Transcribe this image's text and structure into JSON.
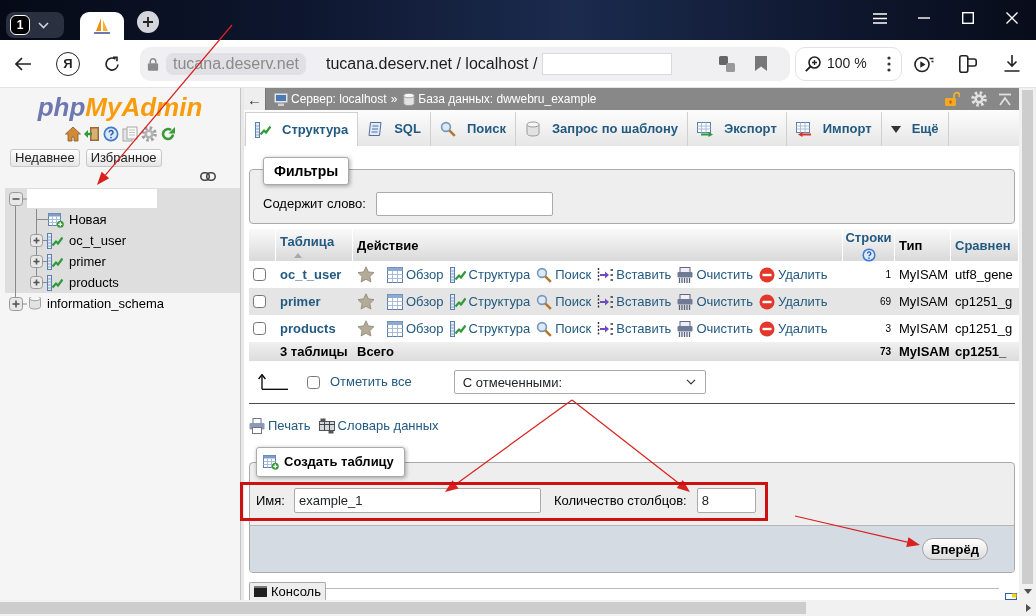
{
  "browser": {
    "tab_counter": "1",
    "logo_letter": "Я",
    "address_chip": "tucana.deserv.net",
    "address": "tucana.deserv.net / localhost /",
    "address_redacted": true,
    "zoom": "100 %"
  },
  "sidebar": {
    "logo": [
      {
        "text": "php",
        "color": "#6c78af"
      },
      {
        "text": "MyAdmin",
        "color": "#f89c0e"
      }
    ],
    "buttons": [
      "Недавнее",
      "Избранное"
    ],
    "tree": [
      {
        "kind": "database",
        "redacted": true,
        "selected": true,
        "expanded": true,
        "children": [
          {
            "kind": "new",
            "label": "Новая"
          },
          {
            "kind": "table",
            "label": "oc_t_user",
            "expanded": false
          },
          {
            "kind": "table",
            "label": "primer",
            "expanded": false
          },
          {
            "kind": "table",
            "label": "products",
            "expanded": false
          }
        ]
      },
      {
        "kind": "database",
        "label": "information_schema",
        "redacted": false,
        "selected": false,
        "expanded": false
      }
    ]
  },
  "main": {
    "nav_toggle": "←",
    "breadcrumbs": [
      {
        "kind": "server",
        "label": "Сервер: localhost",
        "separator": "»"
      },
      {
        "kind": "database",
        "label": "База данных: dwwebru_example"
      }
    ],
    "tabs": [
      {
        "kind": "structure",
        "label": "Структура",
        "selected": true
      },
      {
        "kind": "sql",
        "label": "SQL",
        "selected": false
      },
      {
        "kind": "search",
        "label": "Поиск",
        "selected": false
      },
      {
        "kind": "query",
        "label": "Запрос по шаблону",
        "selected": false
      },
      {
        "kind": "export",
        "label": "Экспорт",
        "selected": false
      },
      {
        "kind": "import",
        "label": "Импорт",
        "selected": false
      },
      {
        "kind": "more",
        "label": "Ещё",
        "selected": false
      }
    ],
    "filters": {
      "legend": "Фильтры",
      "label": "Содержит слово:"
    },
    "table": {
      "columns": [
        {
          "kind": "sortable",
          "label": "Таблица",
          "sorted": true,
          "help": false
        },
        {
          "kind": "plain",
          "label": "Действие",
          "sorted": false,
          "help": false
        },
        {
          "kind": "sortable",
          "label": "Строки",
          "sorted": false,
          "help": true
        },
        {
          "kind": "plain",
          "label": "Тип",
          "sorted": false,
          "help": false
        },
        {
          "kind": "sortable",
          "label": "Сравнен",
          "sorted": false,
          "help": false
        }
      ],
      "rows": [
        {
          "checked": false,
          "name": "oc_t_user",
          "favorite": false,
          "actions": [
            {
              "kind": "browse",
              "label": "Обзор"
            },
            {
              "kind": "structure",
              "label": "Структура"
            },
            {
              "kind": "search",
              "label": "Поиск"
            },
            {
              "kind": "insert",
              "label": "Вставить"
            },
            {
              "kind": "empty",
              "label": "Очистить"
            },
            {
              "kind": "drop",
              "label": "Удалить"
            }
          ],
          "row_count": "1",
          "engine": "MyISAM",
          "collation": "utf8_gene"
        },
        {
          "checked": false,
          "name": "primer",
          "favorite": false,
          "actions": [
            {
              "kind": "browse",
              "label": "Обзор"
            },
            {
              "kind": "structure",
              "label": "Структура"
            },
            {
              "kind": "search",
              "label": "Поиск"
            },
            {
              "kind": "insert",
              "label": "Вставить"
            },
            {
              "kind": "empty",
              "label": "Очистить"
            },
            {
              "kind": "drop",
              "label": "Удалить"
            }
          ],
          "row_count": "69",
          "engine": "MyISAM",
          "collation": "cp1251_g"
        },
        {
          "checked": false,
          "name": "products",
          "favorite": false,
          "actions": [
            {
              "kind": "browse",
              "label": "Обзор"
            },
            {
              "kind": "structure",
              "label": "Структура"
            },
            {
              "kind": "search",
              "label": "Поиск"
            },
            {
              "kind": "insert",
              "label": "Вставить"
            },
            {
              "kind": "empty",
              "label": "Очистить"
            },
            {
              "kind": "drop",
              "label": "Удалить"
            }
          ],
          "row_count": "3",
          "engine": "MyISAM",
          "collation": "cp1251_g"
        }
      ],
      "summary": {
        "count": "3 таблицы",
        "label": "Всего",
        "row_count": "73",
        "engine": "MyISAM",
        "collation": "cp1251_"
      }
    },
    "bulk": {
      "check_all": {
        "label": "Отметить все",
        "checked": false
      },
      "with_selected": "С отмеченными:"
    },
    "links": [
      {
        "kind": "print",
        "label": "Печать"
      },
      {
        "kind": "dictionary",
        "label": "Словарь данных"
      }
    ],
    "create_table": {
      "legend": "Создать таблицу",
      "name_label": "Имя:",
      "name_value": "example_1",
      "columns_label": "Количество столбцов:",
      "columns_value": "8",
      "submit": "Вперёд"
    },
    "console": {
      "label": "Консоль"
    }
  },
  "annotations": [
    {
      "kind": "arrow"
    },
    {
      "kind": "arrow"
    },
    {
      "kind": "arrow"
    },
    {
      "kind": "arrow"
    },
    {
      "kind": "frame"
    }
  ]
}
